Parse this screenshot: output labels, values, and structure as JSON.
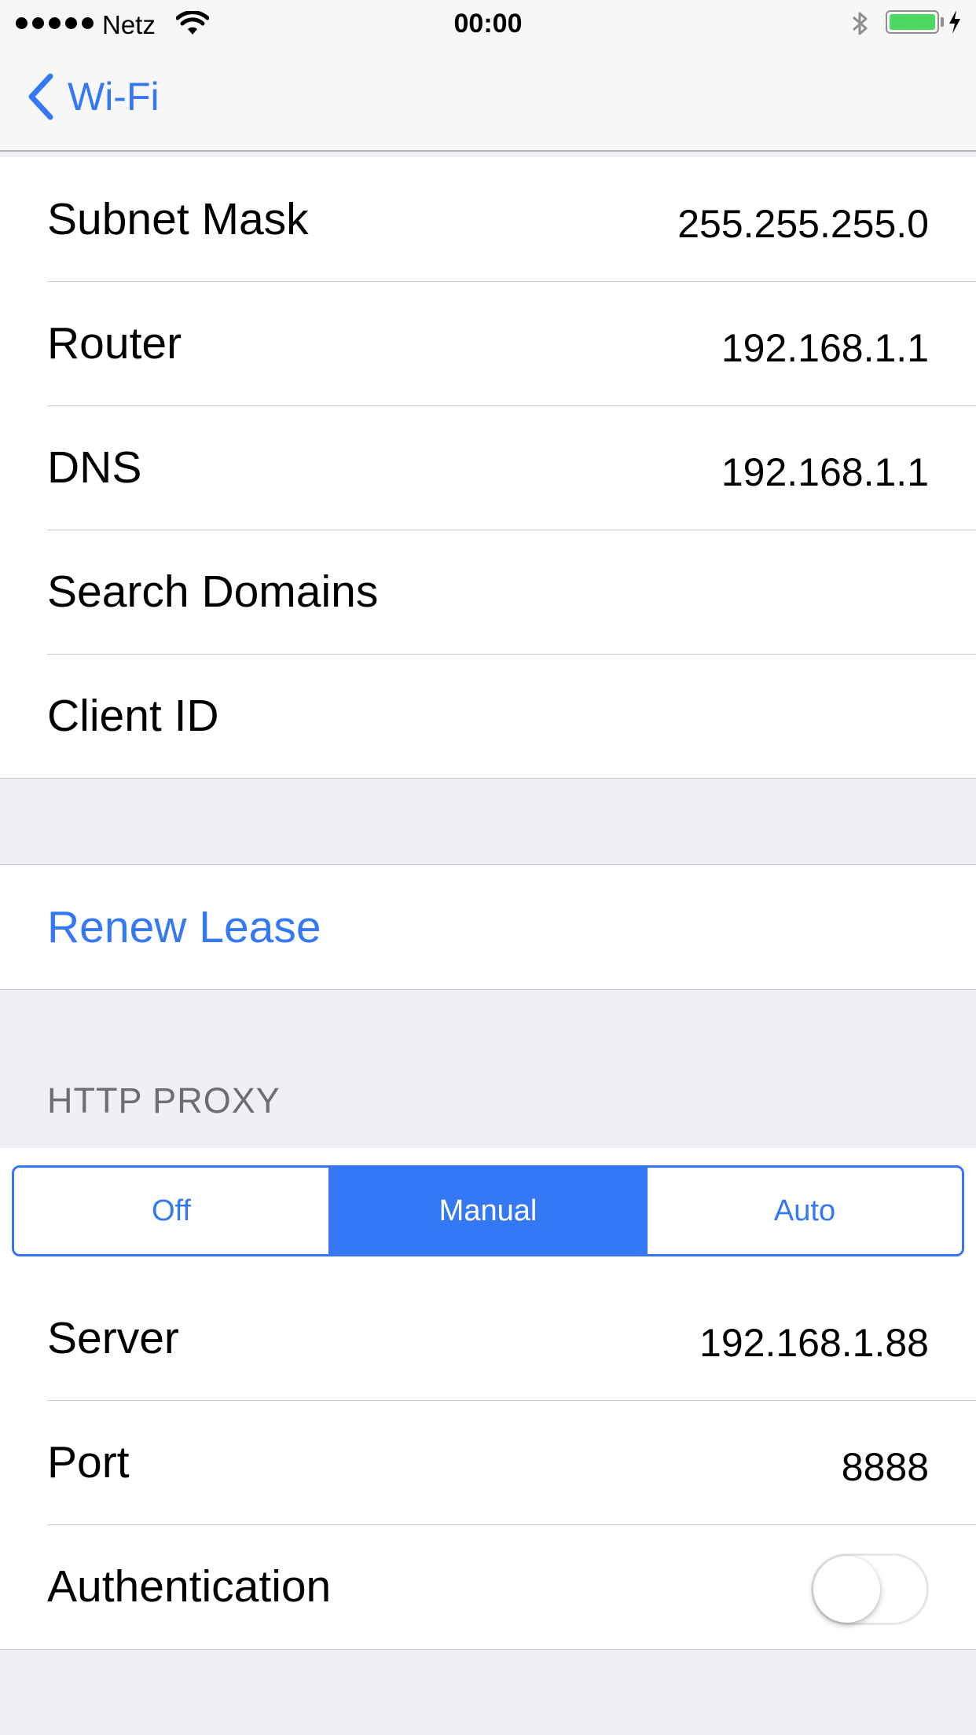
{
  "status_bar": {
    "carrier": "Netz",
    "time": "00:00",
    "battery_percent": 100,
    "battery_color": "#4cd964",
    "icons": [
      "signal-dots-icon",
      "wifi-icon",
      "bluetooth-icon",
      "battery-icon",
      "charging-bolt-icon"
    ]
  },
  "nav": {
    "back_label": "Wi-Fi",
    "back_icon": "chevron-left-icon"
  },
  "details": {
    "rows": [
      {
        "label": "Subnet Mask",
        "value": "255.255.255.0"
      },
      {
        "label": "Router",
        "value": "192.168.1.1"
      },
      {
        "label": "DNS",
        "value": "192.168.1.1"
      },
      {
        "label": "Search Domains",
        "value": ""
      },
      {
        "label": "Client ID",
        "value": ""
      }
    ]
  },
  "renew_lease": {
    "label": "Renew Lease"
  },
  "http_proxy": {
    "header": "HTTP PROXY",
    "segments": [
      "Off",
      "Manual",
      "Auto"
    ],
    "selected_segment": "Manual",
    "rows": [
      {
        "label": "Server",
        "value": "192.168.1.88"
      },
      {
        "label": "Port",
        "value": "8888"
      }
    ],
    "authentication": {
      "label": "Authentication",
      "enabled": false
    }
  },
  "colors": {
    "accent": "#3478f6",
    "background": "#efeff4",
    "separator": "#c8c7cc",
    "section_header": "#6d6d72"
  }
}
